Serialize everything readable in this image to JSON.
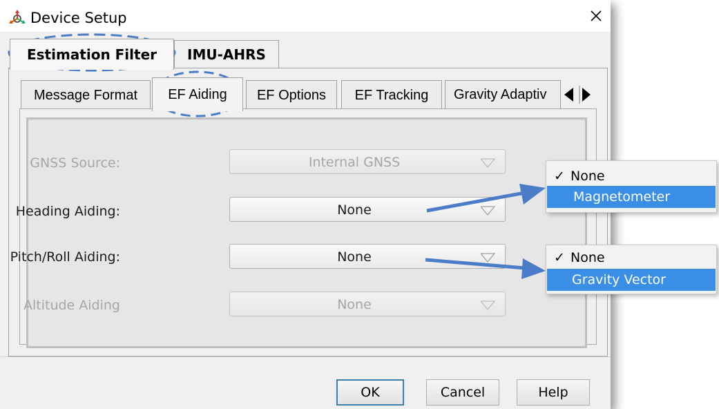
{
  "window": {
    "title": "Device Setup",
    "icon": "axes-icon",
    "close_glyph": "✕"
  },
  "outer_tabs": [
    {
      "label": "Estimation Filter",
      "active": true
    },
    {
      "label": "IMU-AHRS",
      "active": false
    }
  ],
  "inner_tabs": [
    {
      "label": "Message Format",
      "active": false
    },
    {
      "label": "EF Aiding",
      "active": true
    },
    {
      "label": "EF Options",
      "active": false
    },
    {
      "label": "EF Tracking",
      "active": false
    },
    {
      "label": "Gravity Adaptiv",
      "active": false
    }
  ],
  "tab_scroll": {
    "left_icon": "triangle-left-icon",
    "right_icon": "triangle-right-icon"
  },
  "form": {
    "gnss_source": {
      "label": "GNSS Source:",
      "value": "Internal GNSS",
      "enabled": false
    },
    "heading_aiding": {
      "label": "Heading Aiding:",
      "value": "None",
      "enabled": true
    },
    "pitch_roll_aiding": {
      "label": "Pitch/Roll Aiding:",
      "value": "None",
      "enabled": true
    },
    "altitude_aiding": {
      "label": "Altitude Aiding",
      "value": "None",
      "enabled": false
    }
  },
  "heading_dropdown": {
    "options": [
      {
        "label": "None",
        "checked": true,
        "highlighted": false
      },
      {
        "label": "Magnetometer",
        "checked": false,
        "highlighted": true
      }
    ]
  },
  "pitch_roll_dropdown": {
    "options": [
      {
        "label": "None",
        "checked": true,
        "highlighted": false
      },
      {
        "label": "Gravity Vector",
        "checked": false,
        "highlighted": true
      }
    ]
  },
  "buttons": {
    "ok": "OK",
    "cancel": "Cancel",
    "help": "Help"
  },
  "colors": {
    "highlight": "#3a8ee6",
    "annotation": "#4a7cc7",
    "disabled_text": "#a6a6a6"
  }
}
